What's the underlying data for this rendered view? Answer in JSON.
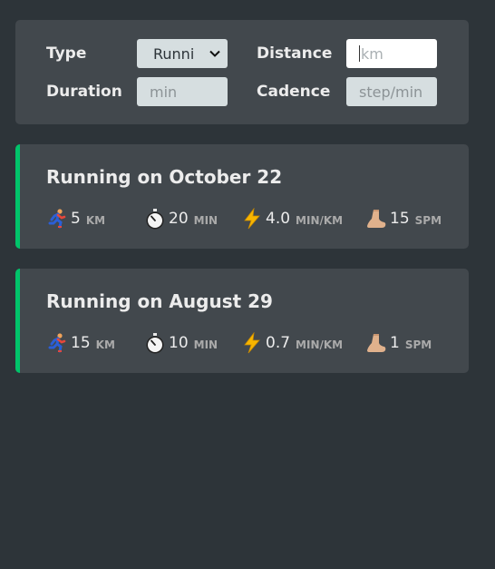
{
  "form": {
    "type_label": "Type",
    "type_value": "Runni",
    "distance_label": "Distance",
    "distance_placeholder": "km",
    "duration_label": "Duration",
    "duration_placeholder": "min",
    "cadence_label": "Cadence",
    "cadence_placeholder": "step/min"
  },
  "workouts": [
    {
      "title": "Running on October 22",
      "distance": "5",
      "distance_unit": "KM",
      "duration": "20",
      "duration_unit": "MIN",
      "pace": "4.0",
      "pace_unit": "MIN/KM",
      "cadence": "15",
      "cadence_unit": "SPM"
    },
    {
      "title": "Running on August 29",
      "distance": "15",
      "distance_unit": "KM",
      "duration": "10",
      "duration_unit": "MIN",
      "pace": "0.7",
      "pace_unit": "MIN/KM",
      "cadence": "1",
      "cadence_unit": "SPM"
    }
  ],
  "colors": {
    "accent_running": "#00c46a",
    "background": "#2d3439",
    "card": "#42484d"
  },
  "icons": {
    "distance": "runner-icon",
    "duration": "stopwatch-icon",
    "pace": "lightning-icon",
    "cadence": "foot-icon"
  }
}
